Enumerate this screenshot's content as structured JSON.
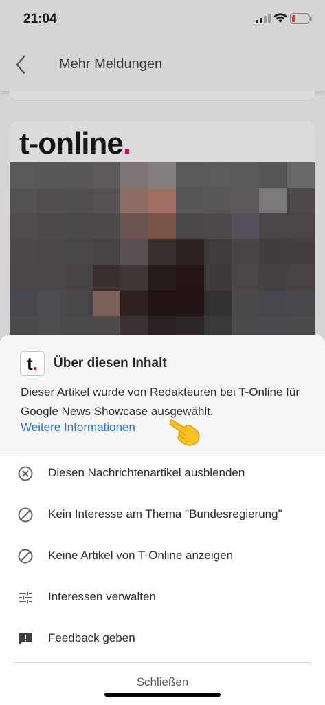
{
  "status_bar": {
    "time": "21:04",
    "icons": [
      "signal-icon",
      "wifi-icon",
      "battery-low-icon"
    ],
    "battery_color": "#e53935"
  },
  "app_bar": {
    "back_icon": "chevron-left-icon",
    "title": "Mehr Meldungen"
  },
  "article_card": {
    "publisher": "t-online",
    "publisher_dot": ".",
    "brand_color": "#d80066"
  },
  "sheet": {
    "source_icon_letter": "t",
    "source_icon_dot": ".",
    "title": "Über diesen Inhalt",
    "description": "Dieser Artikel wurde von Redakteuren bei T-Online für Google News Showcase ausgewählt.",
    "link_label": "Weitere Informationen",
    "link_color": "#1a73e8",
    "menu_items": [
      {
        "icon": "circle-x-icon",
        "label": "Diesen Nachrichtenartikel ausblenden"
      },
      {
        "icon": "block-icon",
        "label": "Kein Interesse am Thema \"Bundesregierung\""
      },
      {
        "icon": "block-icon",
        "label": "Keine Artikel von T-Online anzeigen"
      },
      {
        "icon": "tune-icon",
        "label": "Interessen verwalten"
      },
      {
        "icon": "feedback-icon",
        "label": "Feedback geben"
      }
    ],
    "close_label": "Schließen"
  }
}
